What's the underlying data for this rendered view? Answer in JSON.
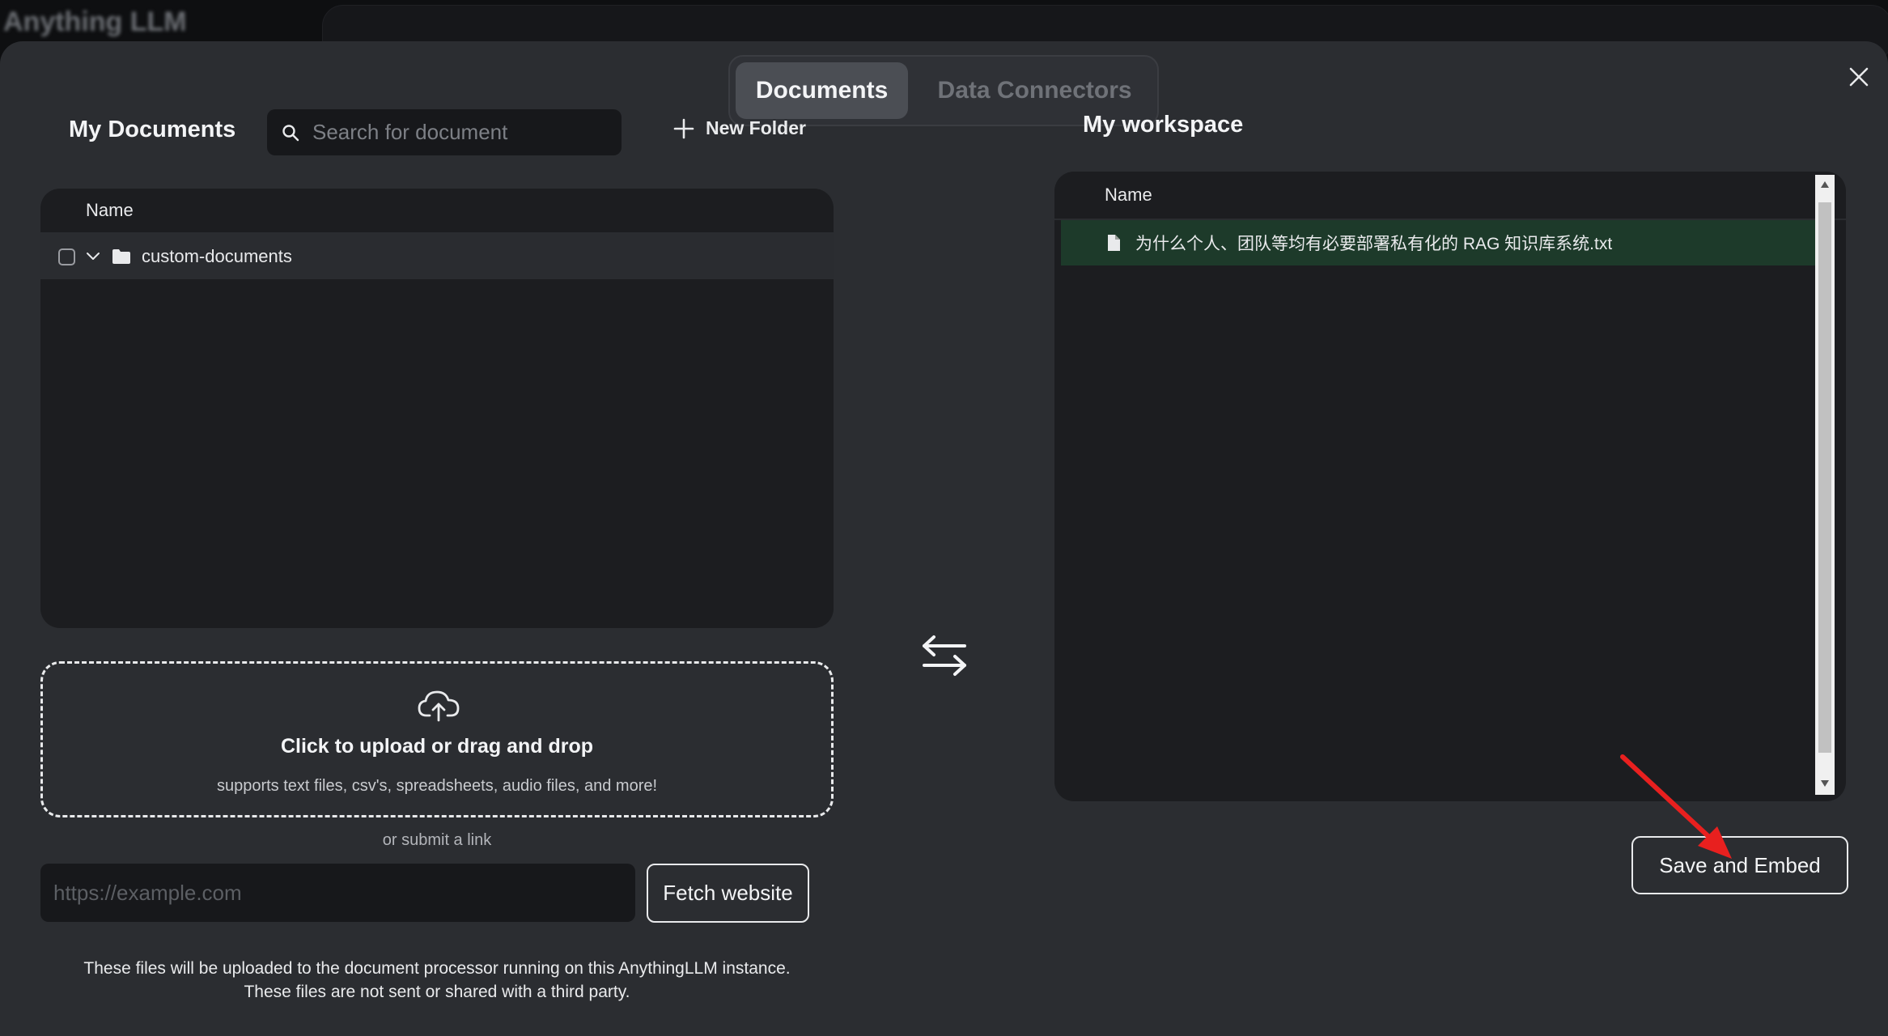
{
  "background": {
    "app_logo": "Anything LLM"
  },
  "tabs": [
    {
      "label": "Documents",
      "active": true
    },
    {
      "label": "Data Connectors",
      "active": false
    }
  ],
  "left": {
    "title": "My Documents",
    "search_placeholder": "Search for document",
    "new_folder_label": "New Folder",
    "column_name": "Name",
    "folders": [
      {
        "name": "custom-documents",
        "checked": false,
        "expanded": false
      }
    ]
  },
  "upload": {
    "title": "Click to upload or drag and drop",
    "subtitle": "supports text files, csv's, spreadsheets, audio files, and more!",
    "or_link": "or submit a link",
    "url_placeholder": "https://example.com",
    "fetch_label": "Fetch website",
    "footer_line1": "These files will be uploaded to the document processor running on this AnythingLLM instance.",
    "footer_line2": "These files are not sent or shared with a third party."
  },
  "right": {
    "title": "My workspace",
    "column_name": "Name",
    "files": [
      {
        "name": "为什么个人、团队等均有必要部署私有化的 RAG 知识库系统.txt"
      }
    ],
    "save_label": "Save and Embed"
  },
  "colors": {
    "modal_bg": "#2b2d31",
    "panel_bg": "#1c1d20",
    "selected_file_bg": "#1d3a2a",
    "annotation_arrow": "#e8201f"
  },
  "icons": [
    "search-icon",
    "plus-icon",
    "chevron-down-icon",
    "folder-icon",
    "file-icon",
    "swap-arrows-icon",
    "cloud-upload-icon",
    "close-icon"
  ]
}
